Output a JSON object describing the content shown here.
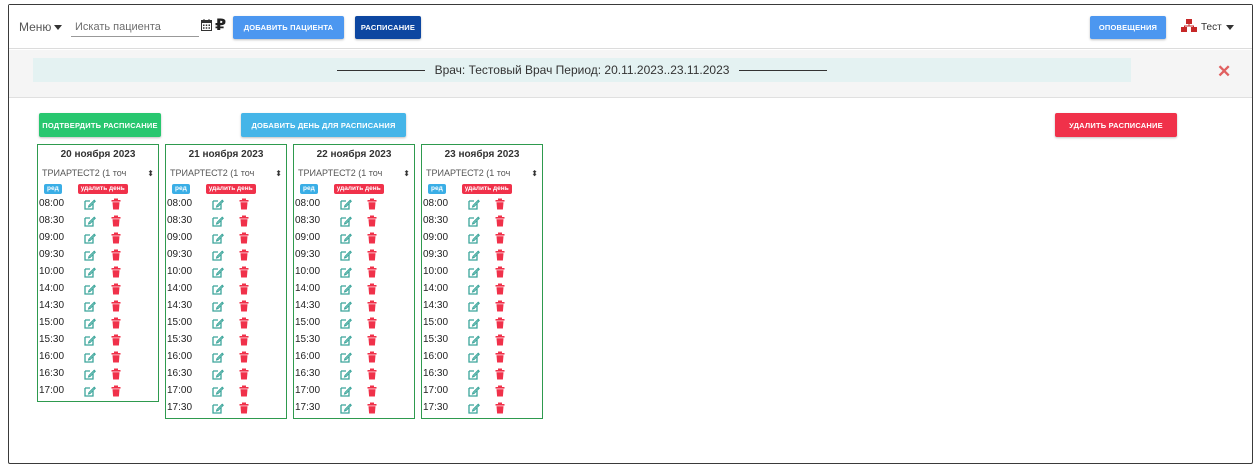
{
  "navbar": {
    "menu_label": "Меню",
    "search_placeholder": "Искать пациента",
    "add_patient_label": "ДОБАВИТЬ ПАЦИЕНТА",
    "schedule_label": "РАСПИСАНИЕ",
    "alerts_label": "ОПОВЕЩЕНИЯ",
    "user_name": "Тест",
    "ruble_symbol": "₽"
  },
  "header": {
    "title": "Врач: Тестовый Врач Период: 20.11.2023..23.11.2023",
    "close_symbol": "✕"
  },
  "actions": {
    "confirm_label": "ПОДТВЕРДИТЬ РАСПИСАНИЕ",
    "add_day_label": "ДОБАВИТЬ ДЕНЬ ДЛЯ РАСПИСАНИЯ",
    "delete_label": "УДАЛИТЬ РАСПИСАНИЕ"
  },
  "colors": {
    "green": "#28c76f",
    "light_blue": "#45b5e8",
    "red": "#f0314a",
    "navy": "#0d47a1",
    "blue": "#4c97f0"
  },
  "days": [
    {
      "date": "20 ноября 2023",
      "select": "ТРИАРТЕСТ2 (1 точ",
      "edit_tag": "ред",
      "delete_tag": "удалить день",
      "slots": [
        "08:00",
        "08:30",
        "09:00",
        "09:30",
        "10:00",
        "14:00",
        "14:30",
        "15:00",
        "15:30",
        "16:00",
        "16:30",
        "17:00"
      ]
    },
    {
      "date": "21 ноября 2023",
      "select": "ТРИАРТЕСТ2 (1 точ",
      "edit_tag": "ред",
      "delete_tag": "удалить день",
      "slots": [
        "08:00",
        "08:30",
        "09:00",
        "09:30",
        "10:00",
        "14:00",
        "14:30",
        "15:00",
        "15:30",
        "16:00",
        "16:30",
        "17:00",
        "17:30"
      ]
    },
    {
      "date": "22 ноября 2023",
      "select": "ТРИАРТЕСТ2 (1 точ",
      "edit_tag": "ред",
      "delete_tag": "удалить день",
      "slots": [
        "08:00",
        "08:30",
        "09:00",
        "09:30",
        "10:00",
        "14:00",
        "14:30",
        "15:00",
        "15:30",
        "16:00",
        "16:30",
        "17:00",
        "17:30"
      ]
    },
    {
      "date": "23 ноября 2023",
      "select": "ТРИАРТЕСТ2 (1 точ",
      "edit_tag": "ред",
      "delete_tag": "удалить день",
      "slots": [
        "08:00",
        "08:30",
        "09:00",
        "09:30",
        "10:00",
        "14:00",
        "14:30",
        "15:00",
        "15:30",
        "16:00",
        "16:30",
        "17:00",
        "17:30"
      ]
    }
  ]
}
